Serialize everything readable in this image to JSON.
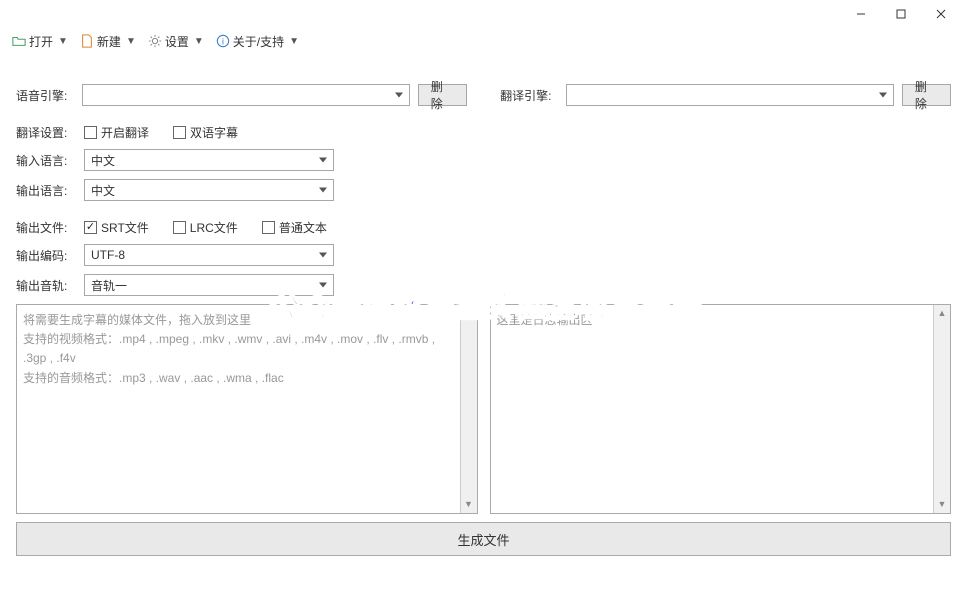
{
  "toolbar": {
    "open": "打开",
    "new": "新建",
    "settings": "设置",
    "about": "关于/支持"
  },
  "engine_row": {
    "voice_label": "语音引擎:",
    "translate_label": "翻译引擎:",
    "delete_btn": "删除"
  },
  "translate_settings": {
    "label": "翻译设置:",
    "enable": "开启翻译",
    "bilingual": "双语字幕"
  },
  "input_lang": {
    "label": "输入语言:",
    "value": "中文"
  },
  "output_lang": {
    "label": "输出语言:",
    "value": "中文"
  },
  "output_file": {
    "label": "输出文件:",
    "srt": "SRT文件",
    "lrc": "LRC文件",
    "plain": "普通文本"
  },
  "output_encoding": {
    "label": "输出编码:",
    "value": "UTF-8"
  },
  "output_track": {
    "label": "输出音轨:",
    "value": "音轨一"
  },
  "drop_area": {
    "line1": "将需要生成字幕的媒体文件，拖入放到这里",
    "line2": "支持的视频格式：.mp4 , .mpeg , .mkv , .wmv , .avi , .m4v , .mov , .flv , .rmvb , .3gp , .f4v",
    "line3": "支持的音频格式：.mp3 , .wav , .aac , .wma , .flac"
  },
  "log_area": {
    "placeholder": "这里是日志输出区"
  },
  "generate_btn": "生成文件",
  "watermark": "公众号循环流量实验室收集整理"
}
